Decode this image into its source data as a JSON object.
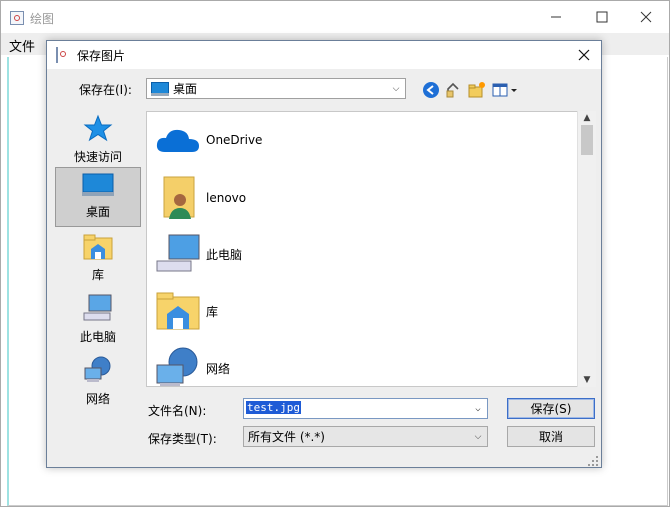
{
  "main_window": {
    "title": "绘图",
    "menu_file": "文件"
  },
  "dialog": {
    "title": "保存图片",
    "look_in_label": "保存在(I):",
    "look_in_value": "桌面",
    "places": [
      {
        "label": "快速访问",
        "icon": "star-icon"
      },
      {
        "label": "桌面",
        "icon": "desktop-icon",
        "selected": true
      },
      {
        "label": "库",
        "icon": "library-icon"
      },
      {
        "label": "此电脑",
        "icon": "computer-icon"
      },
      {
        "label": "网络",
        "icon": "network-icon"
      }
    ],
    "files": [
      {
        "name": "OneDrive",
        "icon": "cloud-icon"
      },
      {
        "name": "lenovo",
        "icon": "user-folder-icon"
      },
      {
        "name": "此电脑",
        "icon": "computer-icon"
      },
      {
        "name": "库",
        "icon": "library-icon"
      },
      {
        "name": "网络",
        "icon": "network-icon"
      }
    ],
    "file_name_label": "文件名(N):",
    "file_name_value": "test.jpg",
    "file_type_label": "保存类型(T):",
    "file_type_value": "所有文件 (*.*)",
    "save_button": "保存(S)",
    "cancel_button": "取消"
  },
  "colors": {
    "accent": "#1e5bd6",
    "canvas_border": "#9ee2e2"
  }
}
